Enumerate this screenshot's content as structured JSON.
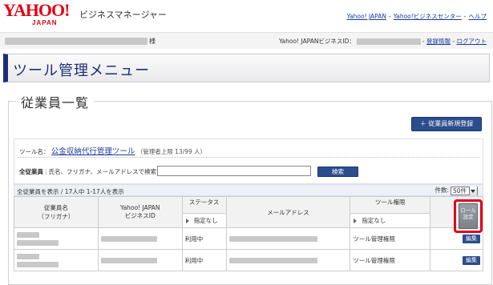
{
  "header": {
    "logo_text": "YAHOO!",
    "logo_sub": "JAPAN",
    "app_name": "ビジネスマネージャー",
    "links": [
      "Yahoo! JAPAN",
      "Yahoo!ビジネスセンター",
      "ヘルプ"
    ]
  },
  "userbar": {
    "honorific": "様",
    "id_label": "Yahoo! JAPANビジネスID：",
    "register": "登録情報",
    "logout": "ログアウト"
  },
  "page": {
    "title": "ツール管理メニュー"
  },
  "employees": {
    "section_title": "従業員一覧",
    "new_button": "＋ 従業員新規登録",
    "tool_label": "ツール名：",
    "tool_name": "公金収納代行管理ツール",
    "tool_limit": "（管理者上限 13/99 人）",
    "search_scope": "全従業員",
    "search_hint": "氏名、フリガナ、メールアドレスで検索",
    "search_button": "検索",
    "count_text": "全従業員を表示 / 17人中 1-17人を表示",
    "per_page_label": "件数:",
    "per_page_value": "50件",
    "columns": {
      "name": "従業員名",
      "name_kana": "（フリガナ）",
      "bizid_1": "Yahoo! JAPAN",
      "bizid_2": "ビジネスID",
      "status": "ステータス",
      "email": "メールアドレス",
      "permission": "ツール権限",
      "role_1": "ロール",
      "role_2": "設定"
    },
    "filters": {
      "status": "指定なし",
      "permission": "指定なし"
    },
    "rows": [
      {
        "status": "利用中",
        "permission": "ツール管理権限",
        "edit": "編集"
      },
      {
        "status": "利用中",
        "permission": "ツール管理権限",
        "edit": "編集"
      }
    ]
  }
}
